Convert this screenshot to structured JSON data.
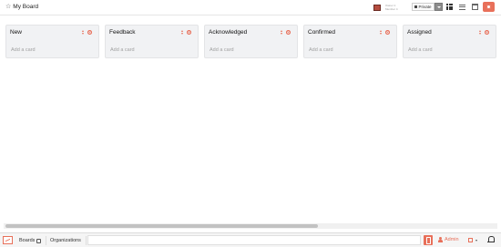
{
  "board": {
    "title": "My Board",
    "star_icon": "star-icon"
  },
  "header": {
    "owner_lines": [
      "Owner 1",
      "Member 4"
    ],
    "visibility_label": "Private",
    "accent": "#e8705a"
  },
  "lists": [
    {
      "title": "New",
      "add_card": "Add a card"
    },
    {
      "title": "Feedback",
      "add_card": "Add a card"
    },
    {
      "title": "Acknowledged",
      "add_card": "Add a card"
    },
    {
      "title": "Confirmed",
      "add_card": "Add a card"
    },
    {
      "title": "Assigned",
      "add_card": "Add a card"
    }
  ],
  "footer": {
    "tabs": {
      "boards": "Boards",
      "organizations": "Organizations"
    },
    "admin_label": "Admin"
  }
}
